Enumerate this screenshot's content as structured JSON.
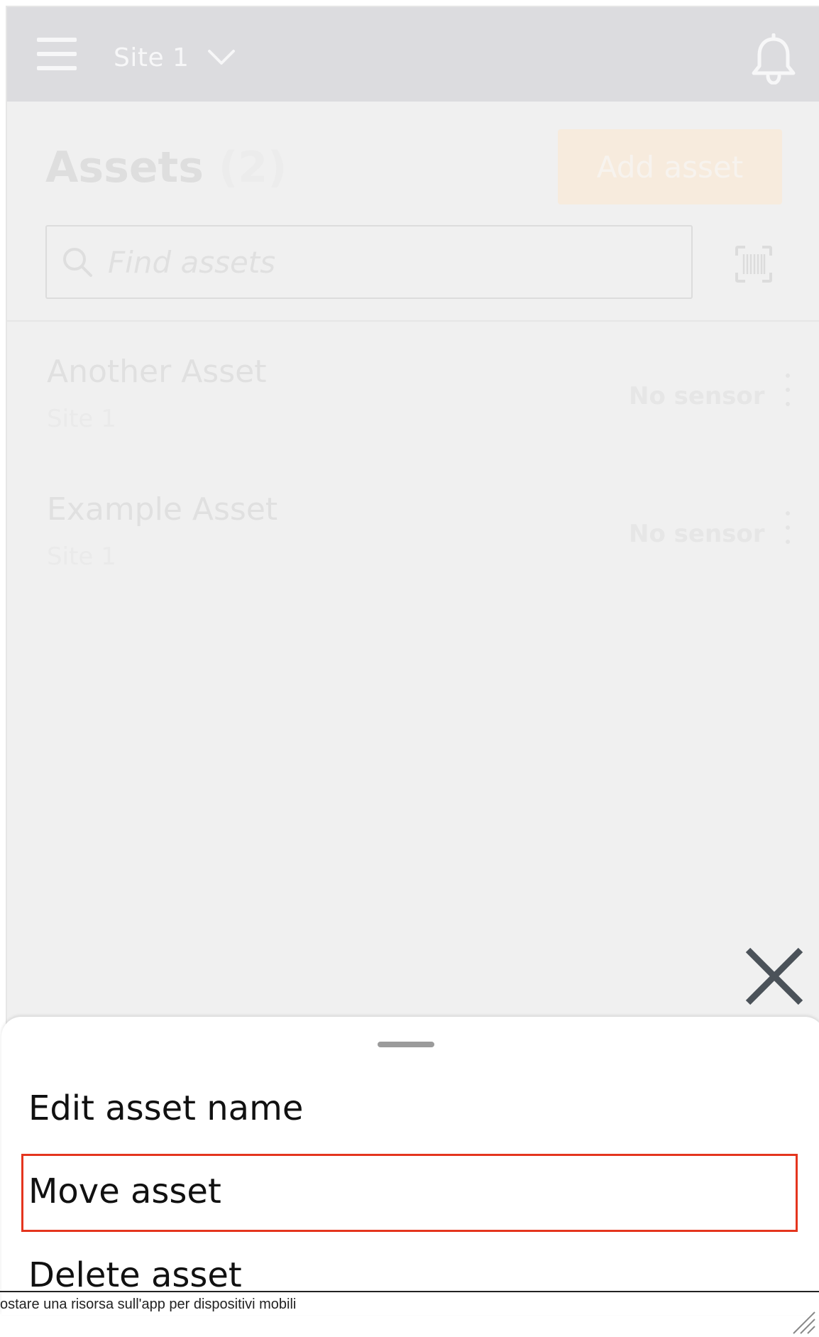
{
  "topbar": {
    "site_name": "Site 1",
    "menu_icon": "hamburger-menu-icon",
    "site_chevron_icon": "chevron-down-icon",
    "notifications_icon": "bell-icon"
  },
  "page": {
    "title": "Assets",
    "count": "(2)",
    "add_button_label": "Add asset"
  },
  "search": {
    "placeholder": "Find assets",
    "value": "",
    "icon": "search-icon",
    "scan_icon": "barcode-scan-icon"
  },
  "assets": [
    {
      "name": "Another Asset",
      "site": "Site 1",
      "status": "No sensor",
      "menu_icon": "more-vertical-icon"
    },
    {
      "name": "Example Asset",
      "site": "Site 1",
      "status": "No sensor",
      "menu_icon": "more-vertical-icon"
    }
  ],
  "close_icon": "close-icon",
  "sheet": {
    "items": [
      {
        "label": "Edit asset name"
      },
      {
        "label": "Move asset"
      },
      {
        "label": "Delete asset"
      }
    ],
    "highlight_color": "#e4351e"
  },
  "caption": {
    "text": "ostare una risorsa sull'app per dispositivi mobili",
    "resize_icon": "resize-grip-icon"
  },
  "colors": {
    "topbar_bg": "#dcdcdf",
    "page_bg": "#f0f0f0",
    "add_button_bg": "#f7ebdd",
    "sheet_bg": "#ffffff",
    "close_icon": "#4b5259"
  }
}
